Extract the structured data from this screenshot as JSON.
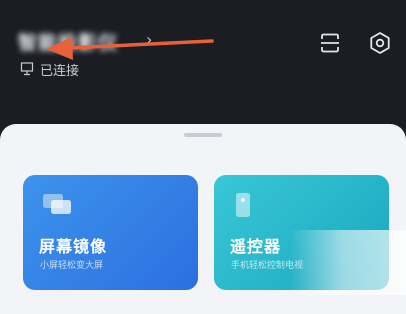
{
  "header": {
    "device_name": "智能投影仪",
    "chevron": "›",
    "status": "已连接"
  },
  "icons": {
    "monitor": "monitor-icon",
    "scan": "scan-icon",
    "settings": "hexagon-settings-icon",
    "arrow": "red-arrow-annotation"
  },
  "colors": {
    "background": "#1b1d22",
    "annotation_arrow": "#e8613a",
    "mirror_card": "#3384e8",
    "remote_card": "#29b9cc"
  },
  "cards": [
    {
      "title": "屏幕镜像",
      "subtitle": "小屏轻松变大屏"
    },
    {
      "title": "遥控器",
      "subtitle": "手机轻松控制电视"
    }
  ]
}
